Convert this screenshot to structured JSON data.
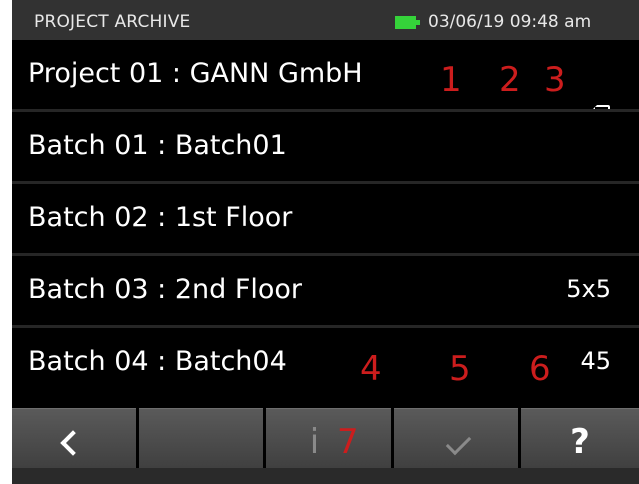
{
  "status_bar": {
    "title": "PROJECT ARCHIVE",
    "battery_color": "#35d33a",
    "datetime": "03/06/19 09:48 am"
  },
  "rows": [
    {
      "label": "Project 01 : GANN GmbH",
      "value": ""
    },
    {
      "label": "Batch 01 : Batch01",
      "value": ""
    },
    {
      "label": "Batch 02 : 1st Floor",
      "value": ""
    },
    {
      "label": "Batch 03 : 2nd Floor",
      "value": "5x5"
    },
    {
      "label": "Batch 04 : Batch04",
      "value": "45"
    }
  ],
  "markers": {
    "m1": "1",
    "m2": "2",
    "m3": "3",
    "m4": "4",
    "m5": "5",
    "m6": "6",
    "m7": "7",
    "color": "#cc1d1d"
  },
  "icons": {
    "storage": "memory-card-icon",
    "back": "chevron-left-icon",
    "info": "info-icon",
    "confirm": "checkmark-icon",
    "help": "question-mark-icon"
  },
  "toolbar": {
    "info_glyph": "i",
    "help_glyph": "?"
  }
}
